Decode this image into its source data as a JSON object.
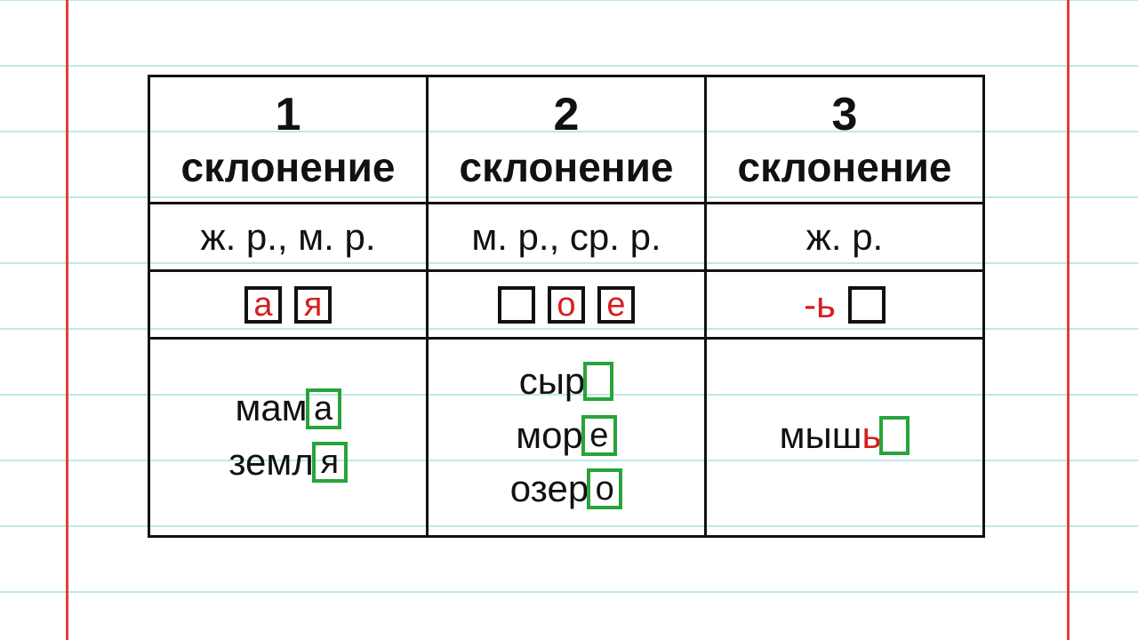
{
  "paper": {
    "hline_ys": [
      -1,
      73,
      147,
      221,
      295,
      369,
      443,
      517,
      591,
      665
    ],
    "vline_xs": [
      74,
      1200
    ]
  },
  "table": {
    "cols": [
      {
        "num": "1",
        "label": "склонение",
        "gender": "ж. р., м. р.",
        "endings": [
          {
            "kind": "box",
            "text": "а"
          },
          {
            "kind": "box",
            "text": "я"
          }
        ],
        "examples": [
          {
            "stem": "мам",
            "suffix": "а"
          },
          {
            "stem": "земл",
            "suffix": "я"
          }
        ]
      },
      {
        "num": "2",
        "label": "склонение",
        "gender": "м. р., ср. р.",
        "endings": [
          {
            "kind": "box",
            "text": ""
          },
          {
            "kind": "box",
            "text": "о"
          },
          {
            "kind": "box",
            "text": "е"
          }
        ],
        "examples": [
          {
            "stem": "сыр",
            "suffix": ""
          },
          {
            "stem": "мор",
            "suffix": "е"
          },
          {
            "stem": "озер",
            "suffix": "о"
          }
        ]
      },
      {
        "num": "3",
        "label": "склонение",
        "gender": "ж. р.",
        "endings": [
          {
            "kind": "text",
            "text": "-ь"
          },
          {
            "kind": "box",
            "text": ""
          }
        ],
        "examples": [
          {
            "stem": "мыш",
            "soft": "ь",
            "suffix": ""
          }
        ]
      }
    ]
  }
}
